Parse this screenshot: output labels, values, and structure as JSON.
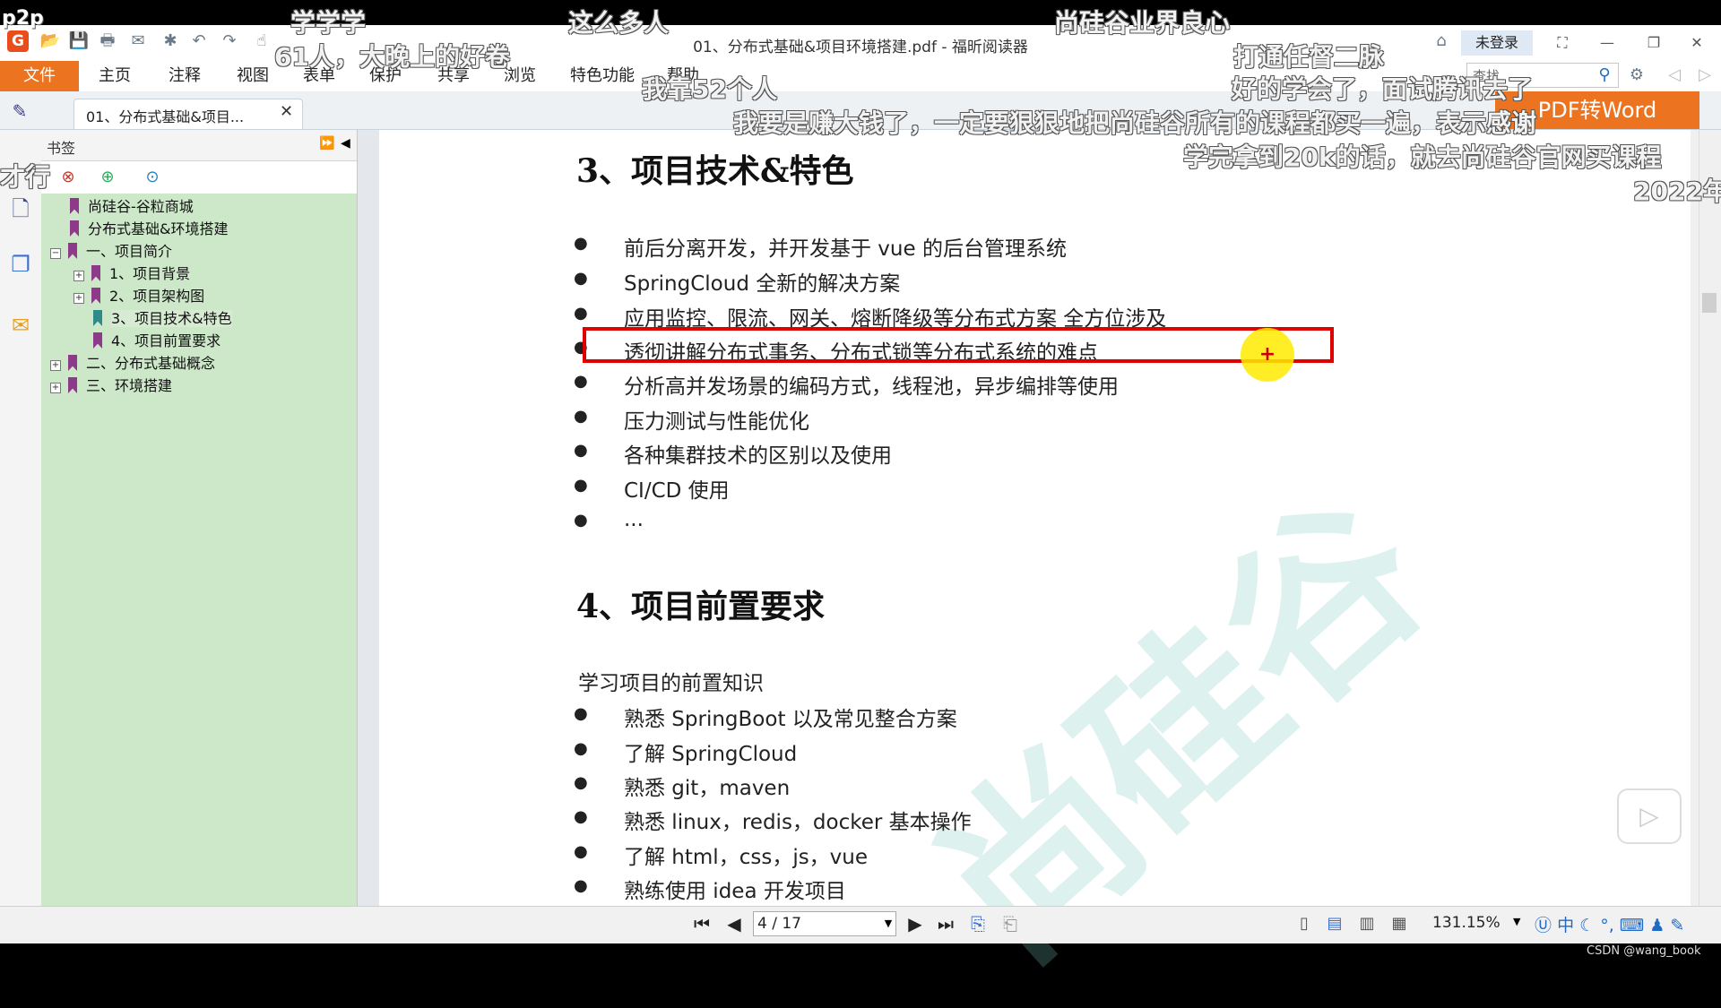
{
  "window": {
    "title": "01、分布式基础&项目环境搭建.pdf - 福昕阅读器",
    "login_label": "未登录"
  },
  "menu": {
    "items": [
      "文件",
      "主页",
      "注释",
      "视图",
      "表单",
      "保护",
      "共享",
      "浏览",
      "特色功能",
      "帮助"
    ],
    "search_placeholder": "查找"
  },
  "tab": {
    "label": "01、分布式基础&项目..."
  },
  "bookmarks": {
    "title": "书签",
    "tree": [
      "尚硅谷-谷粒商城",
      "分布式基础&环境搭建",
      "一、项目简介",
      "1、项目背景",
      "2、项目架构图",
      "3、项目技术&特色",
      "4、项目前置要求",
      "二、分布式基础概念",
      "三、环境搭建"
    ]
  },
  "doc": {
    "section3_title": "3、项目技术&特色",
    "section3_items": [
      "前后分离开发，并开发基于 vue 的后台管理系统",
      "SpringCloud 全新的解决方案",
      "应用监控、限流、网关、熔断降级等分布式方案 全方位涉及",
      "透彻讲解分布式事务、分布式锁等分布式系统的难点",
      "分析高并发场景的编码方式，线程池，异步编排等使用",
      "压力测试与性能优化",
      "各种集群技术的区别以及使用",
      "CI/CD 使用",
      "..."
    ],
    "section4_title": "4、项目前置要求",
    "section4_intro": "学习项目的前置知识",
    "section4_items": [
      "熟悉 SpringBoot 以及常见整合方案",
      "了解 SpringCloud",
      "熟悉 git，maven",
      "熟悉 linux，redis，docker 基本操作",
      "了解 html，css，js，vue",
      "熟练使用 idea 开发项目"
    ],
    "watermark": "尚硅谷"
  },
  "status": {
    "page": "4 / 17",
    "zoom": "131.15%",
    "ime": "中"
  },
  "overlay": {
    "pdf_to_word": "PDF转Word",
    "corner": "p2p",
    "credit": "CSDN @wang_book",
    "danmaku": [
      "学学学",
      "这么多人",
      "尚硅谷业界良心",
      "61人，大晚上的好卷",
      "打通任督二脉",
      "好的学会了，面试腾讯去了",
      "我靠52个人",
      "我要是赚大钱了，一定要狠狠地把尚硅谷所有的课程都买一遍，表示感谢",
      "学完拿到20k的话，就去尚硅谷官网买课程",
      "才行",
      "2022年"
    ]
  }
}
